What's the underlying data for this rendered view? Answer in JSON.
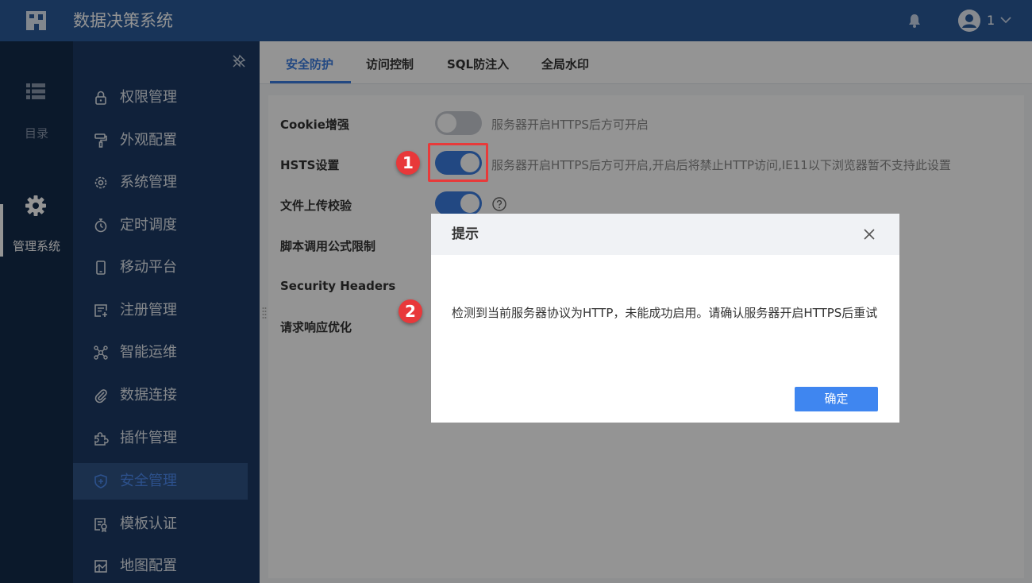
{
  "header": {
    "app_title": "数据决策系统",
    "user_name": "1"
  },
  "rail": {
    "items": [
      {
        "label": "目录",
        "icon": "list-icon"
      },
      {
        "label": "管理系统",
        "icon": "gear-icon"
      }
    ]
  },
  "sidebar": {
    "items": [
      {
        "label": "权限管理",
        "icon": "lock-icon"
      },
      {
        "label": "外观配置",
        "icon": "paint-roller-icon"
      },
      {
        "label": "系统管理",
        "icon": "gear-icon"
      },
      {
        "label": "定时调度",
        "icon": "stopwatch-icon"
      },
      {
        "label": "移动平台",
        "icon": "mobile-icon"
      },
      {
        "label": "注册管理",
        "icon": "register-icon"
      },
      {
        "label": "智能运维",
        "icon": "network-icon"
      },
      {
        "label": "数据连接",
        "icon": "paperclip-icon"
      },
      {
        "label": "插件管理",
        "icon": "puzzle-icon"
      },
      {
        "label": "安全管理",
        "icon": "shield-icon",
        "active": true
      },
      {
        "label": "模板认证",
        "icon": "certificate-icon"
      },
      {
        "label": "地图配置",
        "icon": "map-icon"
      }
    ]
  },
  "tabs": [
    {
      "label": "安全防护",
      "active": true
    },
    {
      "label": "访问控制"
    },
    {
      "label": "SQL防注入"
    },
    {
      "label": "全局水印"
    }
  ],
  "settings": [
    {
      "label": "Cookie增强",
      "desc": "服务器开启HTTPS后方可开启",
      "switch": "off"
    },
    {
      "label": "HSTS设置",
      "desc": "服务器开启HTTPS后方可开启,开启后将禁止HTTP访问,IE11以下浏览器暂不支持此设置",
      "switch": "on"
    },
    {
      "label": "文件上传校验",
      "switch": "on"
    },
    {
      "label": "脚本调用公式限制"
    },
    {
      "label": "Security Headers"
    },
    {
      "label": "请求响应优化"
    }
  ],
  "markers": [
    "1",
    "2"
  ],
  "dialog": {
    "title": "提示",
    "message": "检测到当前服务器协议为HTTP，未能成功启用。请确认服务器开启HTTPS后重试",
    "confirm_label": "确定"
  },
  "colors": {
    "header_bg": "#2a5a99",
    "rail_bg": "#142b4a",
    "sidebar_bg": "#1c3a64",
    "accent": "#3b7ce0",
    "marker": "#e8383a"
  }
}
